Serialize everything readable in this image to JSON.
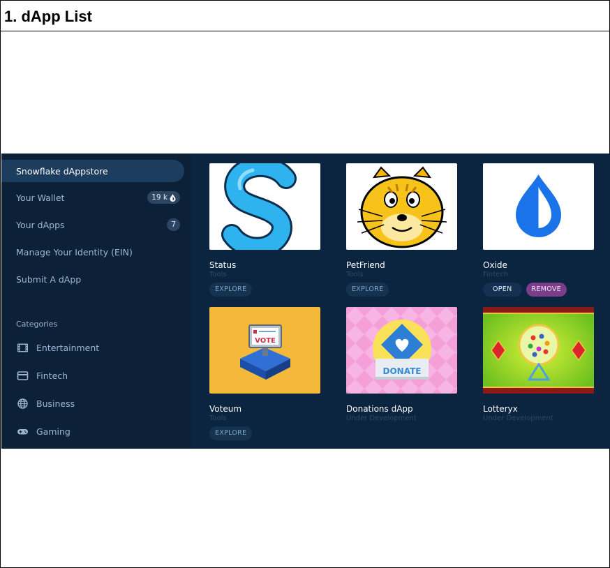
{
  "doc": {
    "title": "1. dApp List"
  },
  "sidebar": {
    "items": [
      {
        "label": "Snowflake dAppstore",
        "active": true
      },
      {
        "label": "Your Wallet",
        "badge": "19 k"
      },
      {
        "label": "Your dApps",
        "badge": "7"
      },
      {
        "label": "Manage Your Identity (EIN)"
      },
      {
        "label": "Submit A dApp"
      }
    ],
    "categories_heading": "Categories",
    "categories": [
      {
        "label": "Entertainment",
        "icon": "film-icon"
      },
      {
        "label": "Fintech",
        "icon": "credit-card-icon"
      },
      {
        "label": "Business",
        "icon": "globe-icon"
      },
      {
        "label": "Gaming",
        "icon": "gamepad-icon"
      }
    ]
  },
  "cards": [
    {
      "title": "Status",
      "category": "Tools",
      "buttons": [
        "EXPLORE"
      ]
    },
    {
      "title": "PetFriend",
      "category": "Tools",
      "buttons": [
        "EXPLORE"
      ]
    },
    {
      "title": "Oxide",
      "category": "Fintech",
      "buttons": [
        "OPEN",
        "REMOVE"
      ]
    },
    {
      "title": "Voteum",
      "category": "Tools",
      "buttons": [
        "EXPLORE"
      ]
    },
    {
      "title": "Donations dApp",
      "category": "Under Development",
      "buttons": []
    },
    {
      "title": "Lotteryx",
      "category": "Under Development",
      "buttons": []
    }
  ],
  "thumb_text": {
    "vote": "VOTE",
    "donate": "DONATE"
  },
  "colors": {
    "app_bg": "#0b2440",
    "sidebar_bg": "#0c2038",
    "active_bg": "#1c3d5e",
    "remove_btn": "#7a3e8a"
  }
}
